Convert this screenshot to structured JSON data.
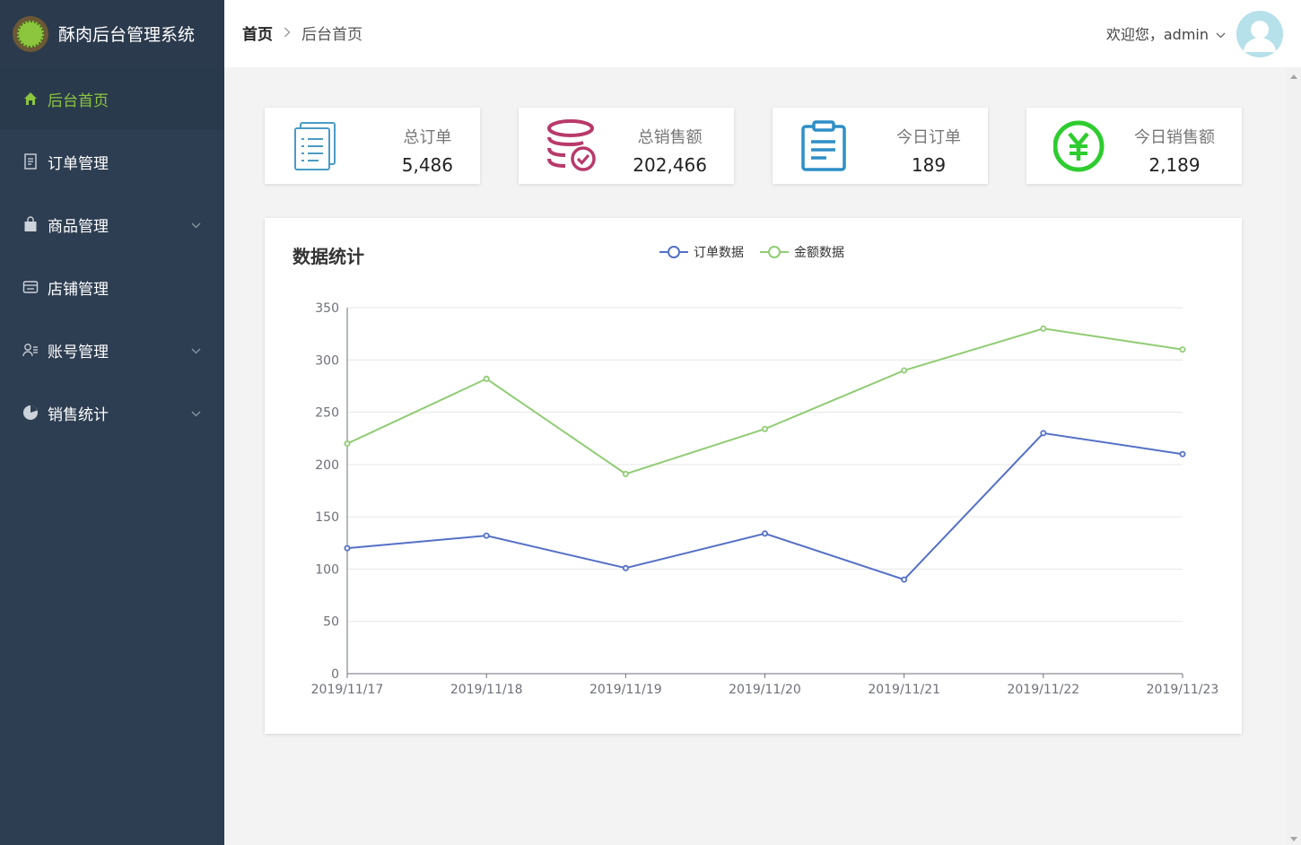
{
  "app": {
    "title": "酥肉后台管理系统"
  },
  "sidebar": {
    "items": [
      {
        "label": "后台首页",
        "icon": "home-icon",
        "active": true,
        "has_submenu": false
      },
      {
        "label": "订单管理",
        "icon": "order-icon",
        "active": false,
        "has_submenu": false
      },
      {
        "label": "商品管理",
        "icon": "bag-icon",
        "active": false,
        "has_submenu": true
      },
      {
        "label": "店铺管理",
        "icon": "store-icon",
        "active": false,
        "has_submenu": false
      },
      {
        "label": "账号管理",
        "icon": "user-list-icon",
        "active": false,
        "has_submenu": true
      },
      {
        "label": "销售统计",
        "icon": "pie-chart-icon",
        "active": false,
        "has_submenu": true
      }
    ]
  },
  "header": {
    "breadcrumb": {
      "home": "首页",
      "separator": ">",
      "current": "后台首页"
    },
    "welcome": "欢迎您，admin"
  },
  "cards": [
    {
      "label": "总订单",
      "value": "5,486",
      "icon": "document-list-icon",
      "color": "#4a9bc4"
    },
    {
      "label": "总销售额",
      "value": "202,466",
      "icon": "coins-check-icon",
      "color": "#b83a6a"
    },
    {
      "label": "今日订单",
      "value": "189",
      "icon": "clipboard-icon",
      "color": "#2e8fc7"
    },
    {
      "label": "今日销售额",
      "value": "2,189",
      "icon": "yuan-circle-icon",
      "color": "#2ecc2e"
    }
  ],
  "chart_panel": {
    "title": "数据统计"
  },
  "colors": {
    "sidebar_bg": "#2e3e52",
    "accent": "#8cc63f",
    "series_order": "#5470c6",
    "series_amount": "#91cc75"
  },
  "chart_data": {
    "type": "line",
    "x": [
      "2019/11/17",
      "2019/11/18",
      "2019/11/19",
      "2019/11/20",
      "2019/11/21",
      "2019/11/22",
      "2019/11/23"
    ],
    "series": [
      {
        "name": "订单数据",
        "values": [
          120,
          132,
          101,
          134,
          90,
          230,
          210
        ],
        "color": "#5470c6"
      },
      {
        "name": "金额数据",
        "values": [
          220,
          282,
          191,
          234,
          290,
          330,
          310
        ],
        "color": "#91cc75"
      }
    ],
    "yticks": [
      0,
      50,
      100,
      150,
      200,
      250,
      300,
      350
    ],
    "ylim": [
      0,
      350
    ],
    "legend_position": "top-center",
    "grid": true
  }
}
